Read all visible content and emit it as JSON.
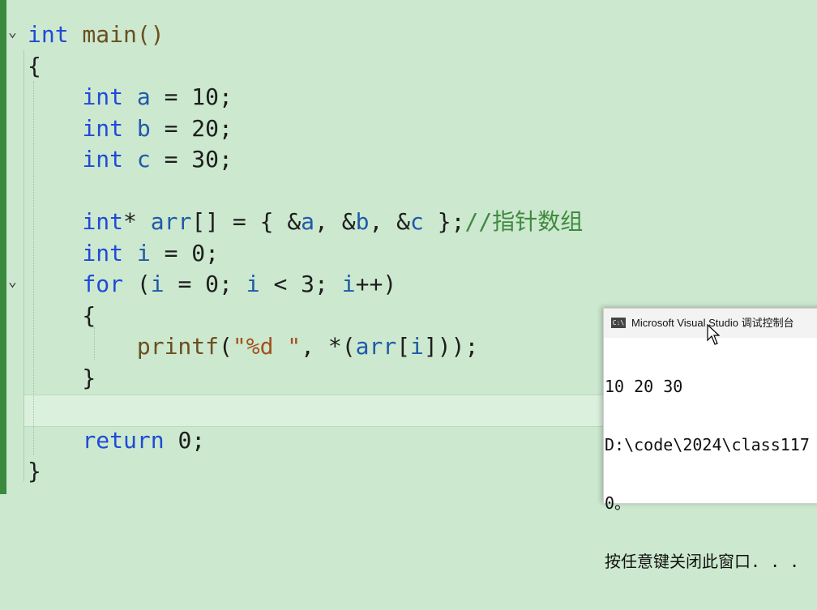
{
  "editor": {
    "lines": [
      [
        {
          "t": "int",
          "c": "kw"
        },
        {
          "t": " main()",
          "c": "fn"
        }
      ],
      [
        {
          "t": "{",
          "c": "plain"
        }
      ],
      [
        {
          "t": "    ",
          "c": "plain"
        },
        {
          "t": "int",
          "c": "kw"
        },
        {
          "t": " a",
          "c": "var"
        },
        {
          "t": " = 10;",
          "c": "plain"
        }
      ],
      [
        {
          "t": "    ",
          "c": "plain"
        },
        {
          "t": "int",
          "c": "kw"
        },
        {
          "t": " b",
          "c": "var"
        },
        {
          "t": " = 20;",
          "c": "plain"
        }
      ],
      [
        {
          "t": "    ",
          "c": "plain"
        },
        {
          "t": "int",
          "c": "kw"
        },
        {
          "t": " c",
          "c": "var"
        },
        {
          "t": " = 30;",
          "c": "plain"
        }
      ],
      [
        {
          "t": "",
          "c": "plain"
        }
      ],
      [
        {
          "t": "    ",
          "c": "plain"
        },
        {
          "t": "int",
          "c": "kw"
        },
        {
          "t": "* ",
          "c": "plain"
        },
        {
          "t": "arr",
          "c": "var"
        },
        {
          "t": "[] = { &",
          "c": "plain"
        },
        {
          "t": "a",
          "c": "var"
        },
        {
          "t": ", &",
          "c": "plain"
        },
        {
          "t": "b",
          "c": "var"
        },
        {
          "t": ", &",
          "c": "plain"
        },
        {
          "t": "c",
          "c": "var"
        },
        {
          "t": " };",
          "c": "plain"
        },
        {
          "t": "//指针数组",
          "c": "cmt"
        }
      ],
      [
        {
          "t": "    ",
          "c": "plain"
        },
        {
          "t": "int",
          "c": "kw"
        },
        {
          "t": " i",
          "c": "var"
        },
        {
          "t": " = 0;",
          "c": "plain"
        }
      ],
      [
        {
          "t": "    ",
          "c": "plain"
        },
        {
          "t": "for",
          "c": "kw"
        },
        {
          "t": " (",
          "c": "plain"
        },
        {
          "t": "i",
          "c": "var"
        },
        {
          "t": " = 0; ",
          "c": "plain"
        },
        {
          "t": "i",
          "c": "var"
        },
        {
          "t": " < 3; ",
          "c": "plain"
        },
        {
          "t": "i",
          "c": "var"
        },
        {
          "t": "++)",
          "c": "plain"
        }
      ],
      [
        {
          "t": "    {",
          "c": "plain"
        }
      ],
      [
        {
          "t": "        ",
          "c": "plain"
        },
        {
          "t": "printf",
          "c": "fn"
        },
        {
          "t": "(",
          "c": "plain"
        },
        {
          "t": "\"%d \"",
          "c": "str"
        },
        {
          "t": ", *(",
          "c": "plain"
        },
        {
          "t": "arr",
          "c": "var"
        },
        {
          "t": "[",
          "c": "plain"
        },
        {
          "t": "i",
          "c": "var"
        },
        {
          "t": "]));",
          "c": "plain"
        }
      ],
      [
        {
          "t": "    }",
          "c": "plain"
        }
      ],
      [
        {
          "t": "",
          "c": "plain"
        }
      ],
      [
        {
          "t": "    ",
          "c": "plain"
        },
        {
          "t": "return",
          "c": "kw"
        },
        {
          "t": " 0;",
          "c": "plain"
        }
      ],
      [
        {
          "t": "}",
          "c": "plain"
        }
      ]
    ],
    "fold_markers": [
      {
        "line": 0,
        "glyph": "⌄"
      },
      {
        "line": 8,
        "glyph": "⌄"
      }
    ]
  },
  "console": {
    "title": "Microsoft Visual Studio 调试控制台",
    "icon_text": "C:\\",
    "output": [
      "10 20 30",
      "D:\\code\\2024\\class117",
      "0。",
      "按任意键关闭此窗口. . ."
    ]
  }
}
